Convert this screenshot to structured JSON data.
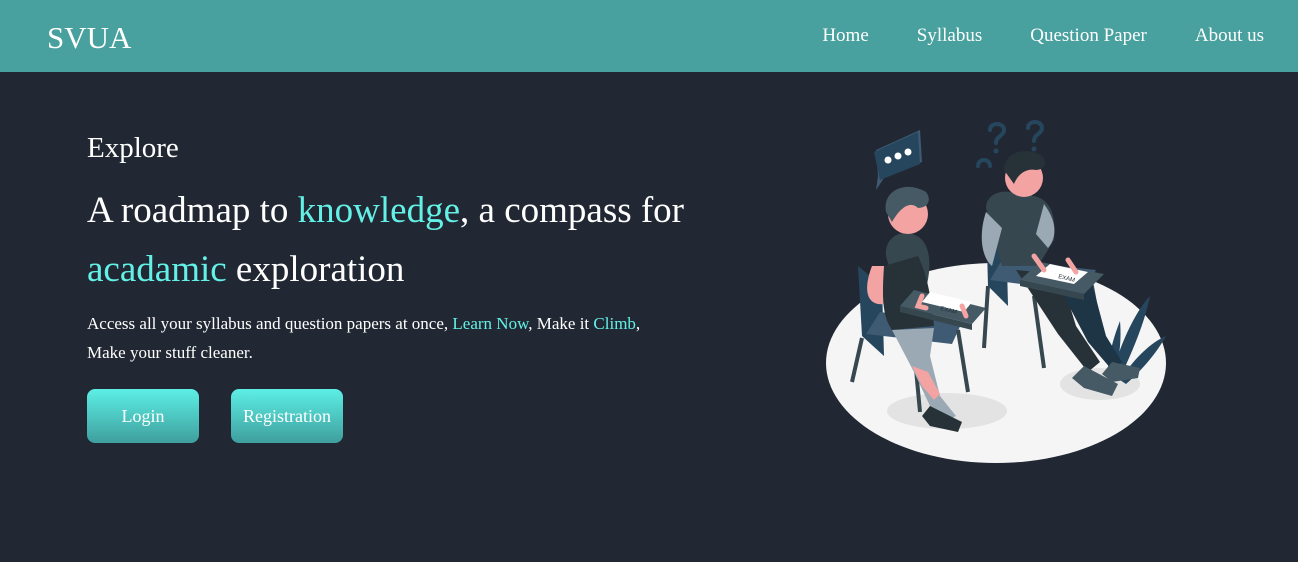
{
  "brand": "SVUA",
  "nav": {
    "items": [
      "Home",
      "Syllabus",
      "Question Paper",
      "About us"
    ]
  },
  "hero": {
    "eyebrow": "Explore",
    "headline": {
      "part1": "A roadmap to ",
      "hl1": "knowledge",
      "part2": ", a compass for ",
      "hl2": "acadamic",
      "part3": " exploration"
    },
    "description": {
      "part1": "Access all your syllabus and question papers at once, ",
      "link1": "Learn Now",
      "part2": ", Make it ",
      "link2": "Climb",
      "part3": ", Make your stuff cleaner."
    },
    "buttons": {
      "login": "Login",
      "registration": "Registration"
    }
  },
  "illustration": {
    "paper_label": "EXAM",
    "accent_colors": {
      "accent": "#63f0e6",
      "header": "#48a19e",
      "background": "#222833"
    }
  }
}
